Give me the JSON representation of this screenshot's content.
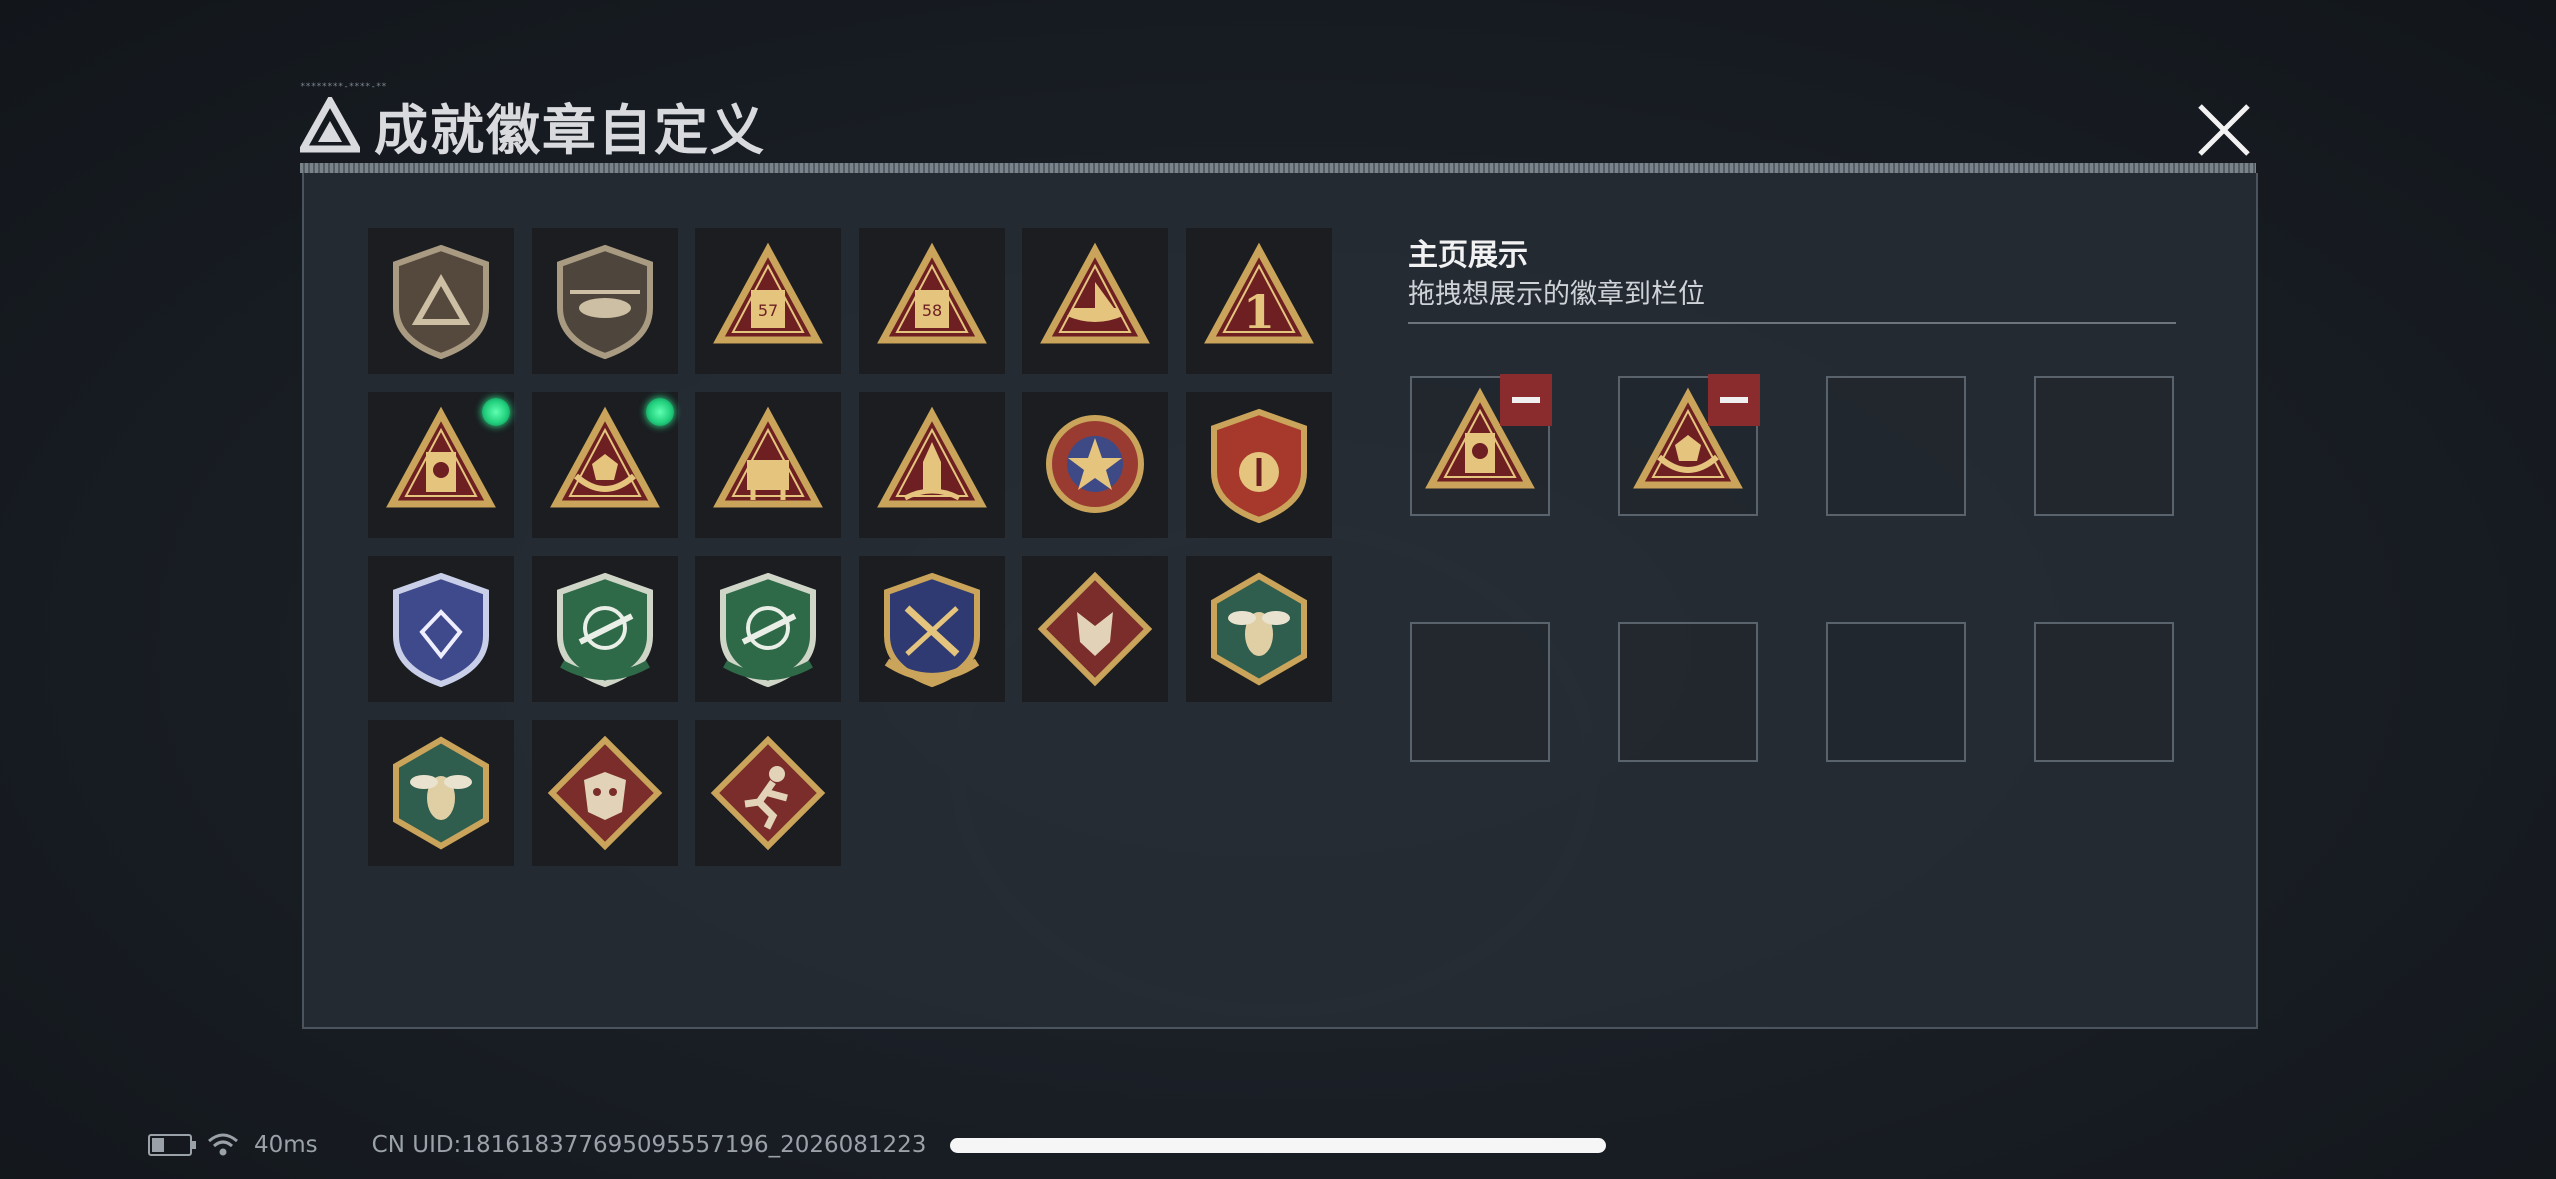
{
  "header": {
    "title": "成就徽章自定义",
    "tiny_text": "********-****-**"
  },
  "collection": {
    "badges": [
      {
        "icon": "shield-triangle-badge-icon",
        "new": false
      },
      {
        "icon": "helicopter-shield-badge-icon",
        "new": false
      },
      {
        "icon": "triangle-57-badge-icon",
        "label": "57",
        "new": false
      },
      {
        "icon": "triangle-58-badge-icon",
        "label": "58",
        "new": false
      },
      {
        "icon": "triangle-ship-badge-icon",
        "new": false
      },
      {
        "icon": "triangle-number-1-badge-icon",
        "label": "1",
        "new": false
      },
      {
        "icon": "triangle-soldier-badge-icon",
        "new": true
      },
      {
        "icon": "triangle-hands-dice-badge-icon",
        "new": true
      },
      {
        "icon": "triangle-mech-badge-icon",
        "new": false
      },
      {
        "icon": "triangle-rocket-badge-icon",
        "new": false
      },
      {
        "icon": "star-wheel-medal-icon",
        "new": false
      },
      {
        "icon": "crest-medal-icon",
        "new": false
      },
      {
        "icon": "diamond-shield-medal-icon",
        "new": false
      },
      {
        "icon": "green-rifle-shield-icon",
        "new": false
      },
      {
        "icon": "green-rifle-shield-icon",
        "new": false
      },
      {
        "icon": "crossed-weapons-shield-icon",
        "new": false
      },
      {
        "icon": "wolf-diamond-badge-icon",
        "new": false
      },
      {
        "icon": "hornet-hexagon-badge-icon",
        "new": false
      },
      {
        "icon": "hornet-hexagon-badge-icon",
        "new": false
      },
      {
        "icon": "dragon-diamond-badge-icon",
        "new": false
      },
      {
        "icon": "runner-diamond-badge-icon",
        "new": false
      }
    ]
  },
  "display": {
    "title": "主页展示",
    "subtitle": "拖拽想展示的徽章到栏位",
    "slots": [
      {
        "filled": true,
        "icon": "triangle-soldier-badge-icon"
      },
      {
        "filled": true,
        "icon": "triangle-hands-dice-badge-icon"
      },
      {
        "filled": false
      },
      {
        "filled": false
      },
      {
        "filled": false
      },
      {
        "filled": false
      },
      {
        "filled": false
      },
      {
        "filled": false
      }
    ]
  },
  "status": {
    "ping": "40ms",
    "uid": "CN UID:1816183776950955571​96_2026081223​"
  },
  "colors": {
    "panel": "#262c34",
    "gold": "#c9a45a",
    "maroon": "#6e1f22",
    "green_dot": "#22d07d",
    "remove_red": "#8a2b2e"
  }
}
